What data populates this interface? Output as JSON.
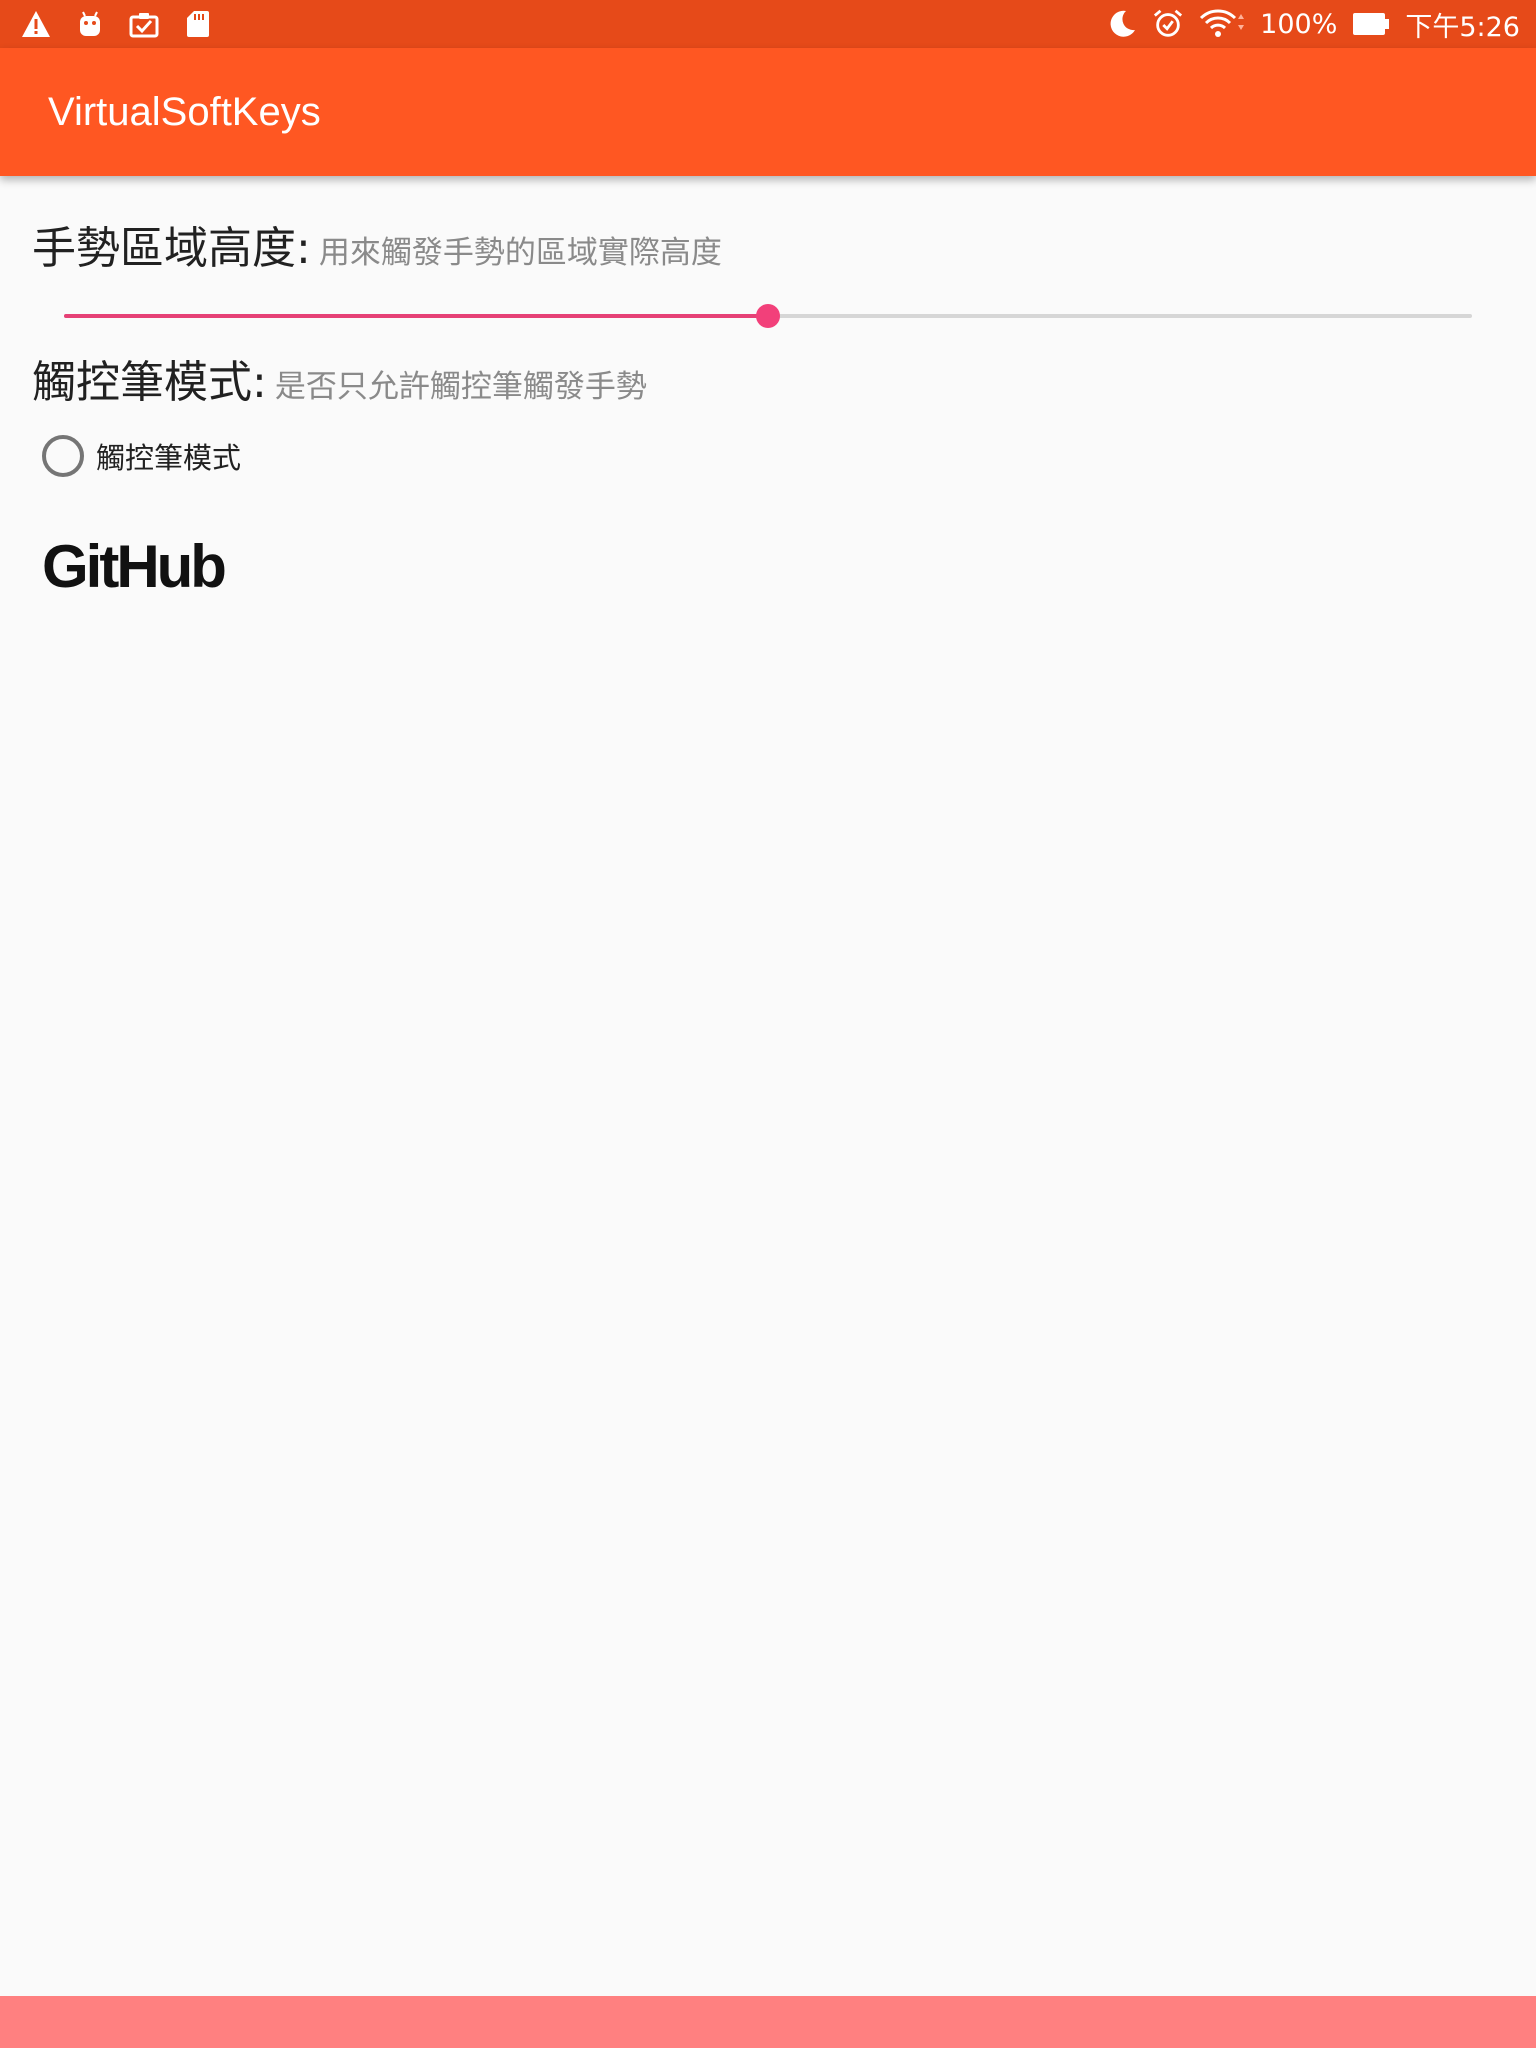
{
  "status_bar": {
    "left_icons": [
      "warning-icon",
      "android-debug-icon",
      "clipboard-check-icon",
      "sd-card-icon"
    ],
    "right_icons": [
      "moon-icon",
      "alarm-icon",
      "wifi-icon",
      "battery-icon"
    ],
    "battery_text": "100%",
    "time": "下午5:26"
  },
  "app_bar": {
    "title": "VirtualSoftKeys"
  },
  "gesture_height": {
    "title": "手勢區域高度:",
    "description": "用來觸發手勢的區域實際高度",
    "slider_level": 0.5
  },
  "stylus_mode": {
    "title": "觸控筆模式:",
    "description": "是否只允許觸控筆觸發手勢",
    "radio_label": "觸控筆模式",
    "checked": false
  },
  "github_link": {
    "label": "GitHub"
  },
  "colors": {
    "status_bar": "#e64a19",
    "app_bar": "#ff5722",
    "accent": "#f2407a",
    "bottom_bar": "#ff8080"
  }
}
